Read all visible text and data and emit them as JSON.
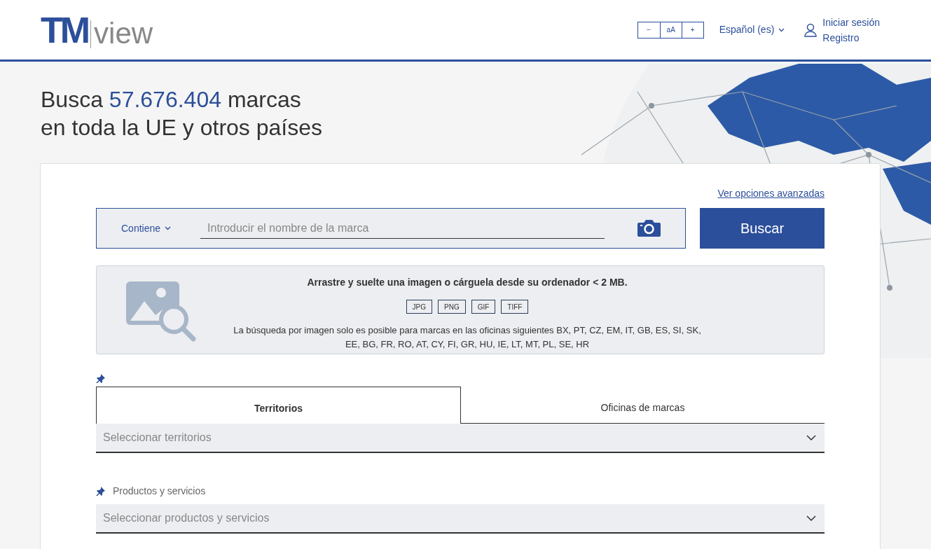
{
  "logo": {
    "mark": "TM",
    "word": "view"
  },
  "font_controls": [
    "−",
    "aA",
    "+"
  ],
  "language": {
    "label": "Español (es)"
  },
  "account": {
    "login": "Iniciar sesión",
    "register": "Registro"
  },
  "headline": {
    "prefix": "Busca ",
    "count": "57.676.404",
    "suffix": " marcas",
    "line2": "en toda la UE y otros países"
  },
  "advanced_link": "Ver opciones avanzadas",
  "search": {
    "mode": "Contiene",
    "placeholder": "Introducir el nombre de la marca",
    "button": "Buscar"
  },
  "image_panel": {
    "title": "Arrastre y suelte una imagen o cárguela desde su ordenador < 2 MB.",
    "formats": [
      "JPG",
      "PNG",
      "GIF",
      "TIFF"
    ],
    "note": "La búsqueda por imagen solo es posible para marcas en las oficinas siguientes BX, PT, CZ, EM, IT, GB, ES, SI, SK, EE, BG, FR, RO, AT, CY, FI, GR, HU, IE, LT, MT, PL, SE, HR"
  },
  "tabs": [
    {
      "label": "Territorios",
      "selected": true
    },
    {
      "label": "Oficinas de marcas",
      "selected": false
    }
  ],
  "territories_select": {
    "placeholder": "Seleccionar territorios"
  },
  "products": {
    "label": "Productos y servicios",
    "placeholder": "Seleccionar productos y servicios"
  }
}
